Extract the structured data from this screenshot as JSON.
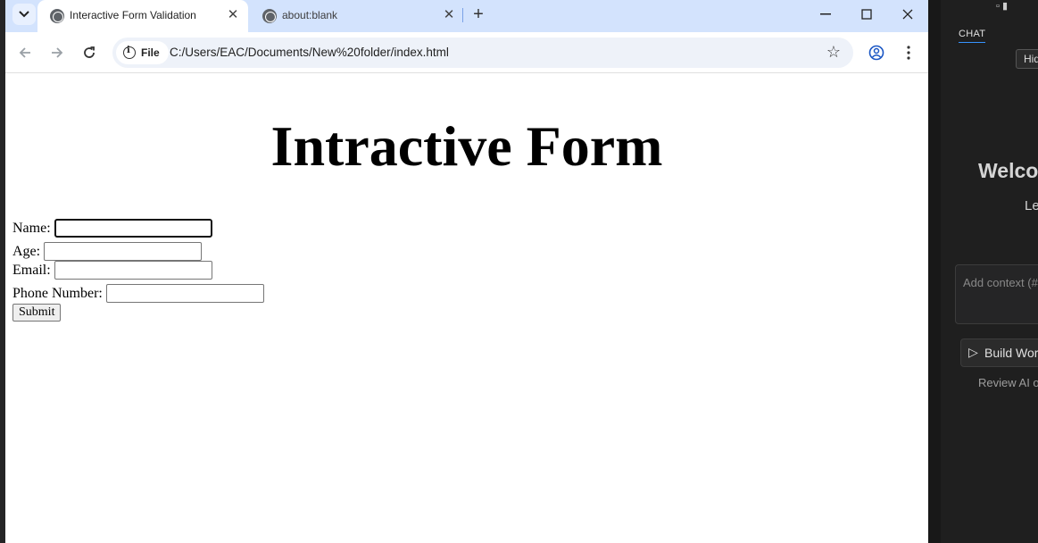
{
  "browser": {
    "tabs": [
      {
        "label": "Interactive Form Validation",
        "active": true
      },
      {
        "label": "about:blank",
        "active": false
      }
    ],
    "address": {
      "chip_label": "File",
      "url": "C:/Users/EAC/Documents/New%20folder/index.html"
    }
  },
  "page": {
    "heading": "Intractive Form",
    "fields": [
      {
        "label": "Name:",
        "value": ""
      },
      {
        "label": "Age:",
        "value": ""
      },
      {
        "label": "Email:",
        "value": ""
      },
      {
        "label": "Phone Number:",
        "value": ""
      }
    ],
    "submit_label": "Submit"
  },
  "side_panel": {
    "chat_tab": "CHAT",
    "hidden_button": "Hid",
    "welcome": "Welco",
    "learn": "Le",
    "context_placeholder": "Add context (#",
    "build_button": "Build Wor",
    "review_text": "Review AI o"
  },
  "colors": {
    "tabstrip": "#d3e3fd",
    "omnibox": "#eef2f9",
    "editor_bg": "#1f1f1f"
  }
}
